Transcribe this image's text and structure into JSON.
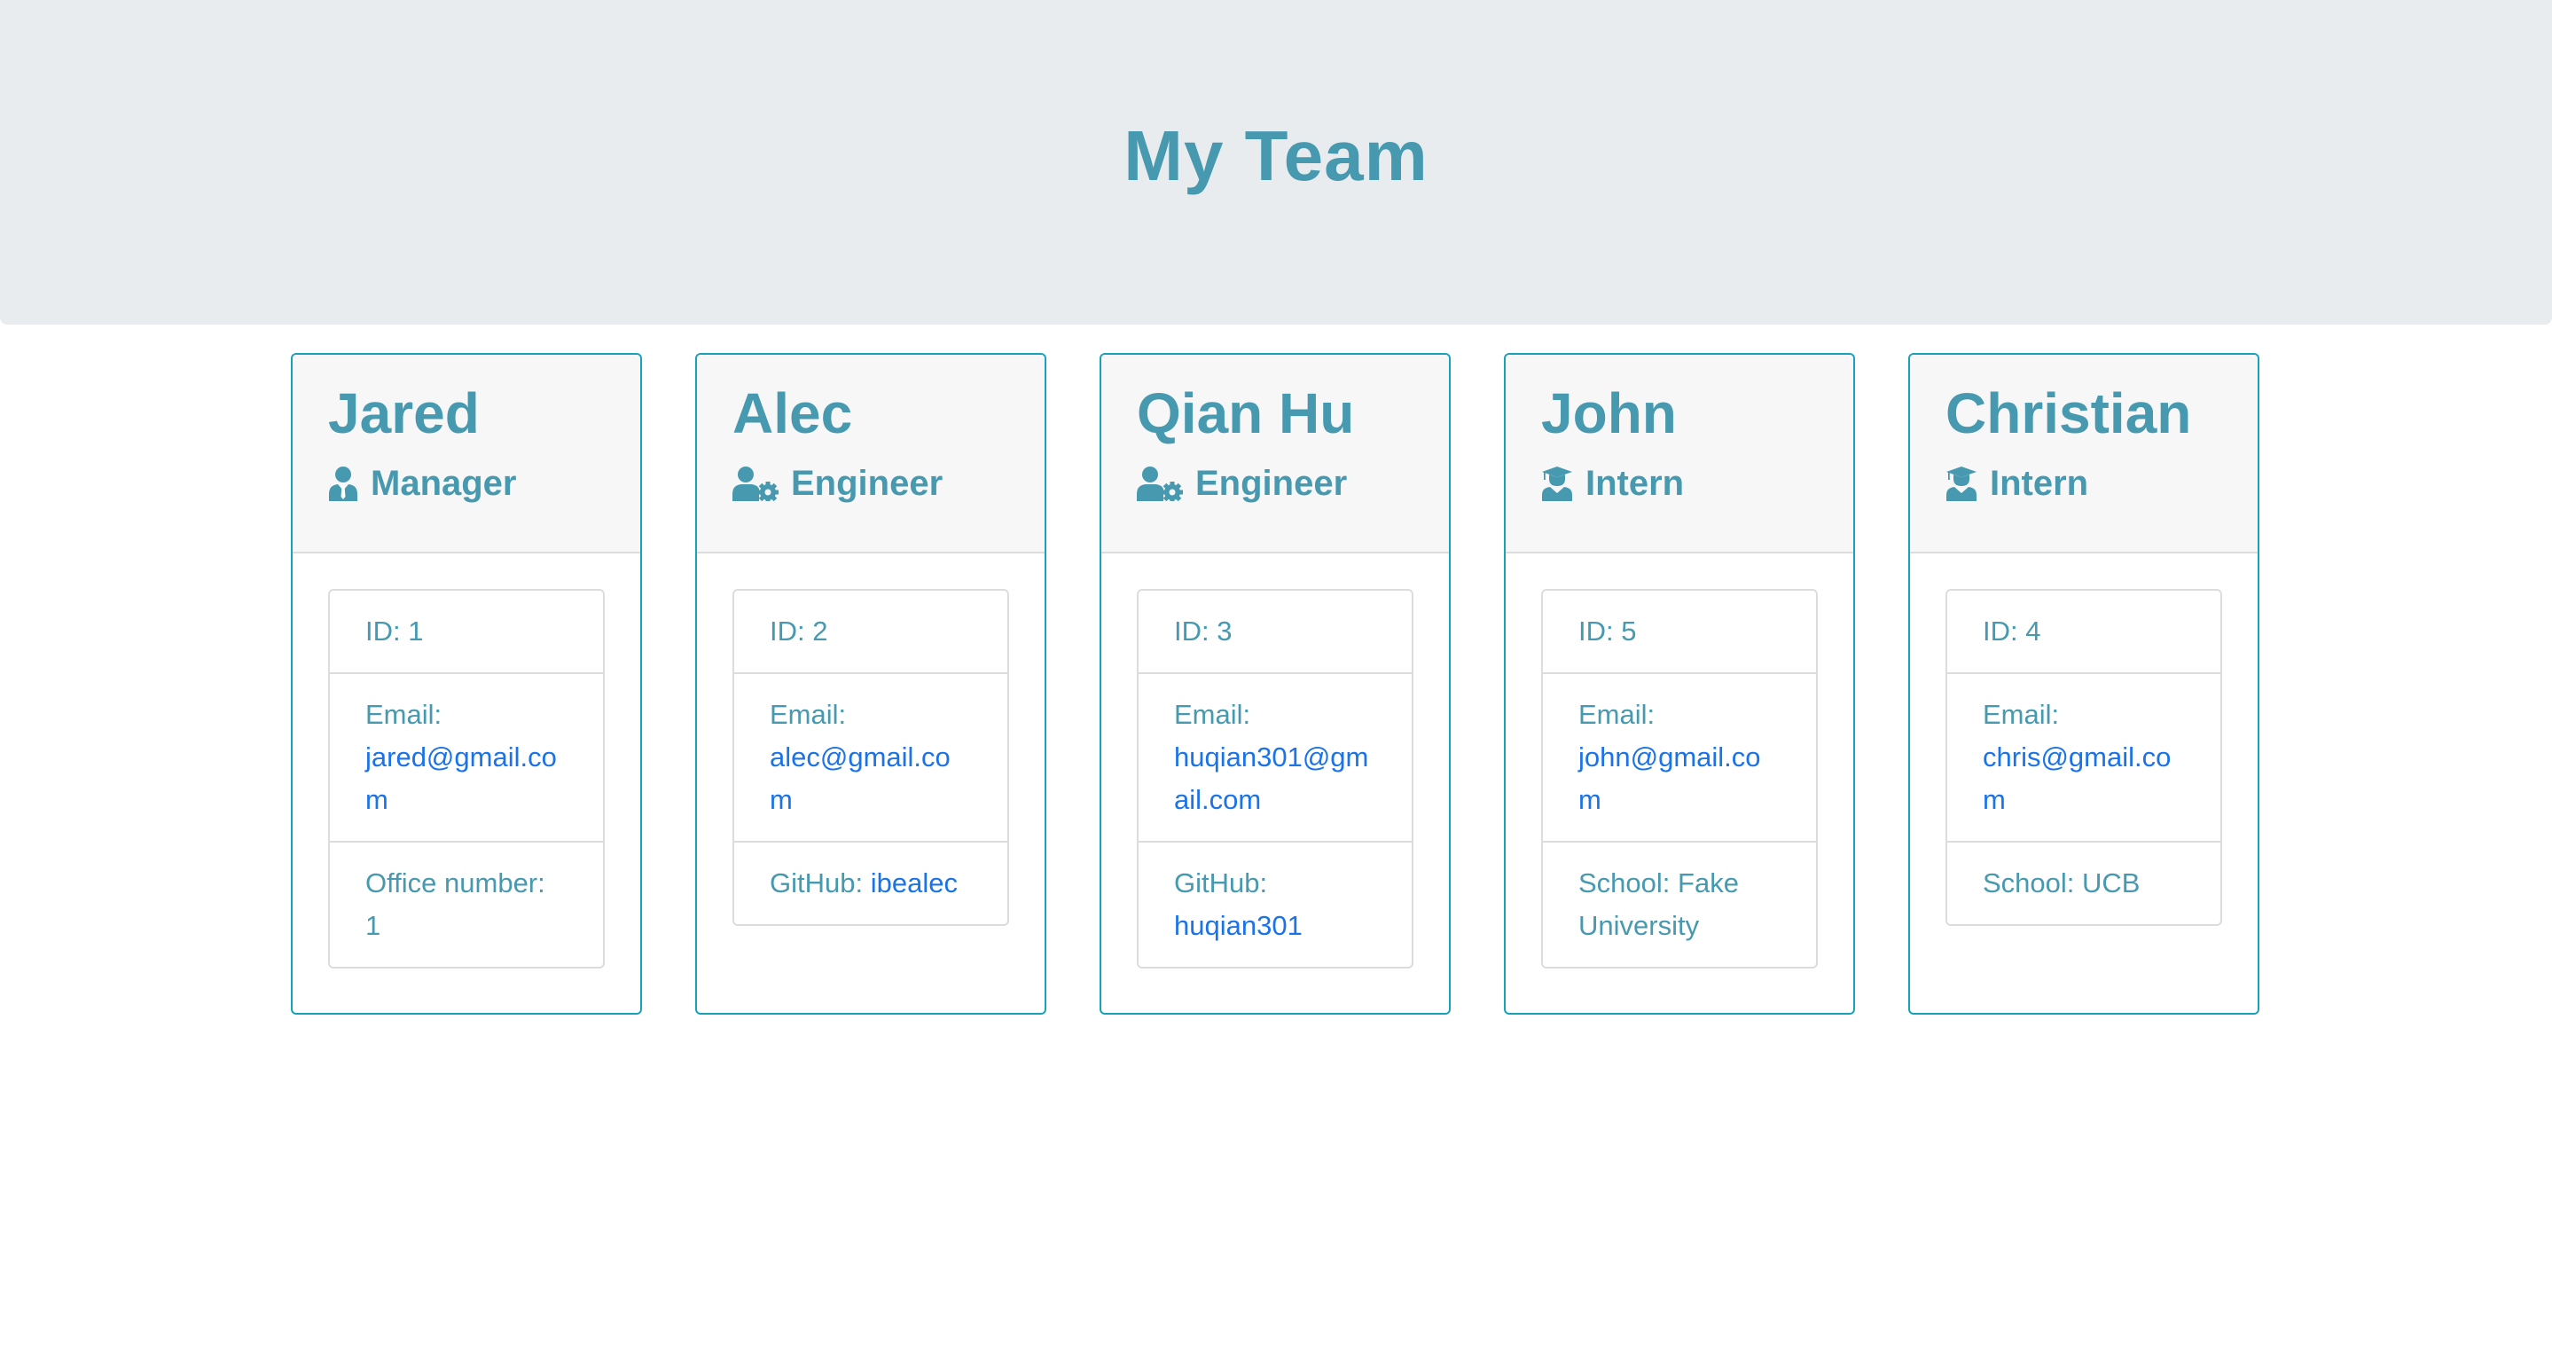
{
  "header": {
    "title": "My Team"
  },
  "cards": [
    {
      "name": "Jared",
      "role": "Manager",
      "role_icon": "user-tie-icon",
      "id_text": "ID: 1",
      "email_label": "Email:",
      "email": "jared@gmail.com",
      "extra_label": "Office number:",
      "extra_value": "1"
    },
    {
      "name": "Alec",
      "role": "Engineer",
      "role_icon": "user-cog-icon",
      "id_text": "ID: 2",
      "email_label": "Email:",
      "email": "alec@gmail.com",
      "extra_label": "GitHub:",
      "extra_value": "ibealec"
    },
    {
      "name": "Qian Hu",
      "role": "Engineer",
      "role_icon": "user-cog-icon",
      "id_text": "ID: 3",
      "email_label": "Email:",
      "email": "huqian301@gmail.com",
      "extra_label": "GitHub:",
      "extra_value": "huqian301"
    },
    {
      "name": "John",
      "role": "Intern",
      "role_icon": "user-graduate-icon",
      "id_text": "ID: 5",
      "email_label": "Email:",
      "email": "john@gmail.com",
      "extra_label": "School:",
      "extra_value": "Fake University"
    },
    {
      "name": "Christian",
      "role": "Intern",
      "role_icon": "user-graduate-icon",
      "id_text": "ID: 4",
      "email_label": "Email:",
      "email": "chris@gmail.com",
      "extra_label": "School:",
      "extra_value": "UCB"
    }
  ],
  "colors": {
    "accent": "#4799b0",
    "link": "#1a73e8",
    "card_border": "#17a2b8",
    "jumbotron_bg": "#e9ecef"
  }
}
